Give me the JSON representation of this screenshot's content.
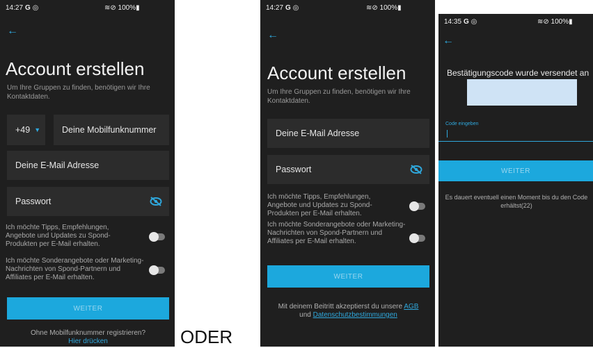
{
  "panel1": {
    "status": {
      "time": "14:27",
      "icons": "G ◎",
      "right": "≋⊘ 100%▮"
    },
    "back_icon": "arrow-left-icon",
    "title": "Account erstellen",
    "subtitle": "Um Ihre Gruppen zu finden, benötigen wir Ihre Kontaktdaten.",
    "country_code": "+49",
    "phone_placeholder": "Deine Mobilfunknummer",
    "email_placeholder": "Deine E-Mail Adresse",
    "password_placeholder": "Passwort",
    "opt1": "Ich möchte Tipps, Empfehlungen, Angebote und Updates zu Spond-Produkten per E-Mail erhalten.",
    "opt2": "Ich möchte Sonderangebote oder Marketing-Nachrichten von Spond-Partnern und Affiliates per E-Mail erhalten.",
    "button": "WEITER",
    "footer_text": "Ohne Mobilfunknummer registrieren?",
    "footer_link": "Hier drücken"
  },
  "separator": "ODER",
  "panel2": {
    "status": {
      "time": "14:27",
      "icons": "G ◎",
      "right": "≋⊘ 100%▮"
    },
    "title": "Account erstellen",
    "subtitle": "Um Ihre Gruppen zu finden, benötigen wir Ihre Kontaktdaten.",
    "email_placeholder": "Deine E-Mail Adresse",
    "password_placeholder": "Passwort",
    "opt1": "Ich möchte Tipps, Empfehlungen, Angebote und Updates zu Spond-Produkten per E-Mail erhalten.",
    "opt2": "Ich möchte Sonderangebote oder Marketing-Nachrichten von Spond-Partnern und Affiliates per E-Mail erhalten.",
    "button": "WEITER",
    "terms_prefix": "Mit deinem Beitritt akzeptierst du unsere",
    "terms_agb": "AGB",
    "terms_and": "und",
    "terms_privacy": "Datenschutzbestimmungen"
  },
  "panel3": {
    "status": {
      "time": "14:35",
      "icons": "G ◎",
      "right": "≋⊘ 100%▮"
    },
    "heading": "Bestätigungscode wurde versendet an",
    "code_label": "Code eingeben",
    "button": "WEITER",
    "info": "Es dauert eventuell einen Moment bis du den Code erhältst(22)"
  },
  "colors": {
    "accent": "#1ca8dd",
    "background": "#1f1f1f",
    "field": "#2c2c2c"
  }
}
